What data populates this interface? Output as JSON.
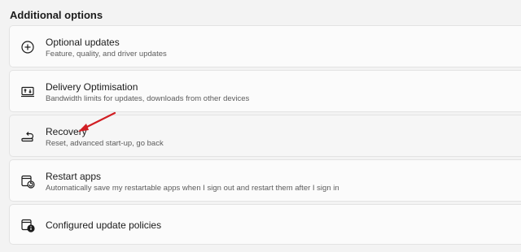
{
  "section": {
    "title": "Additional options"
  },
  "items": [
    {
      "title": "Optional updates",
      "description": "Feature, quality, and driver updates",
      "icon": "plus-circle-icon"
    },
    {
      "title": "Delivery Optimisation",
      "description": "Bandwidth limits for updates, downloads from other devices",
      "icon": "delivery-optimisation-icon"
    },
    {
      "title": "Recovery",
      "description": "Reset, advanced start-up, go back",
      "icon": "recovery-icon"
    },
    {
      "title": "Restart apps",
      "description": "Automatically save my restartable apps when I sign out and restart them after I sign in",
      "icon": "restart-apps-icon"
    },
    {
      "title": "Configured update policies",
      "icon": "policy-info-icon"
    }
  ],
  "colors": {
    "background": "#f3f3f3",
    "card": "#fbfbfb",
    "annotation_arrow": "#d11f24"
  }
}
